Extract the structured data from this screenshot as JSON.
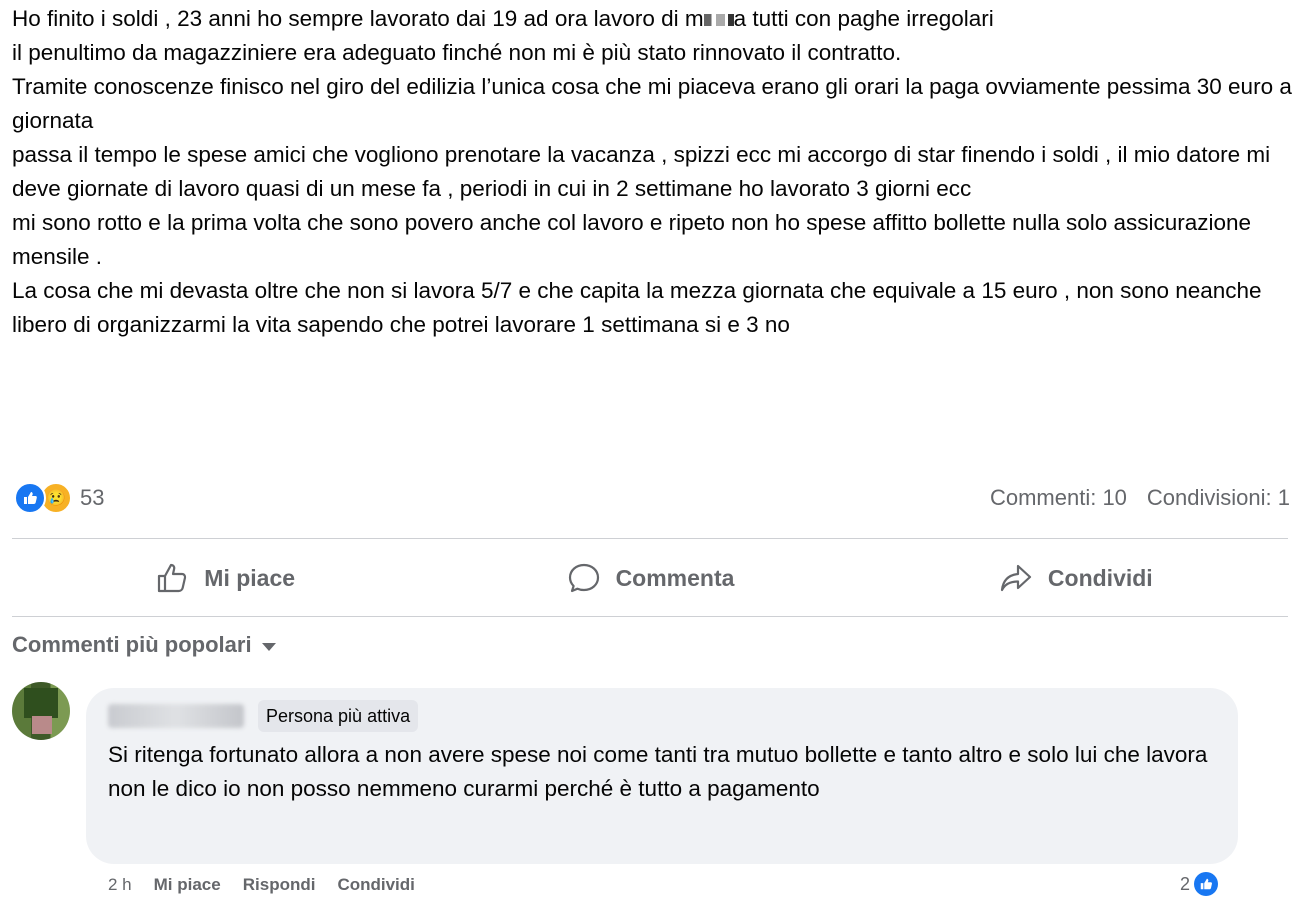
{
  "post": {
    "paragraphs": [
      {
        "before": "Ho finito i soldi , 23 anni ho sempre lavorato dai 19 ad ora lavoro di m",
        "after": "a tutti con paghe irregolari"
      },
      {
        "text": "il penultimo da magazziniere era adeguato finché non mi è più stato rinnovato il contratto."
      },
      {
        "text": "Tramite conoscenze finisco nel giro del edilizia l’unica cosa che mi piaceva erano gli orari la paga ovviamente pessima 30 euro a giornata"
      },
      {
        "text": "passa il tempo le spese amici che vogliono prenotare la vacanza , spizzi ecc mi accorgo di star finendo i soldi , il mio datore mi deve giornate di lavoro quasi di un mese fa , periodi in cui in 2 settimane ho lavorato 3 giorni ecc"
      },
      {
        "text": "mi sono rotto e la prima volta che sono povero anche col lavoro e ripeto non ho spese affitto bollette nulla solo assicurazione mensile ."
      },
      {
        "text": "La cosa che mi devasta oltre che non si lavora 5/7 e che capita la mezza giornata che equivale a 15 euro , non sono neanche libero di organizzarmi la vita sapendo che potrei lavorare 1 settimana si e 3 no"
      }
    ]
  },
  "reactions": {
    "count": "53",
    "comments": "Commenti: 10",
    "shares": "Condivisioni: 1",
    "like_color": "#1877f2",
    "sad_color": "#f7b125"
  },
  "actions": {
    "like": "Mi piace",
    "comment": "Commenta",
    "share": "Condividi"
  },
  "sort": {
    "label": "Commenti più popolari"
  },
  "comment": {
    "badge": "Persona più attiva",
    "text": "Si ritenga fortunato allora a non avere spese noi come tanti tra mutuo bollette e tanto altro e solo lui che lavora non le dico io non posso nemmeno curarmi perché è tutto a pagamento",
    "time": "2 h",
    "like": "Mi piace",
    "reply": "Rispondi",
    "share": "Condividi",
    "likes": "2"
  }
}
